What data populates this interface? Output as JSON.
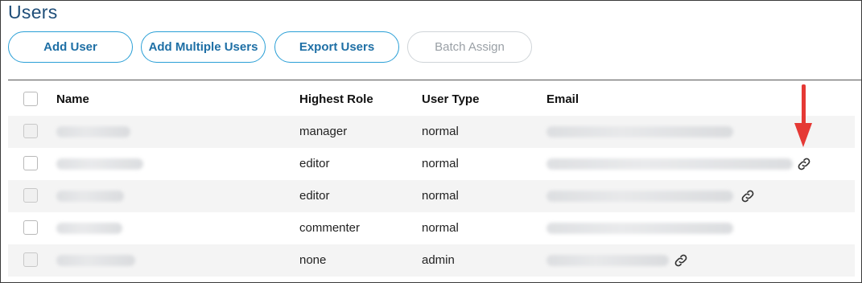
{
  "page": {
    "title": "Users"
  },
  "toolbar": {
    "buttons": [
      {
        "label": "Add User",
        "enabled": true
      },
      {
        "label": "Add Multiple Users",
        "enabled": true
      },
      {
        "label": "Export Users",
        "enabled": true
      },
      {
        "label": "Batch Assign",
        "enabled": false
      }
    ]
  },
  "table": {
    "headers": {
      "name": "Name",
      "role": "Highest Role",
      "type": "User Type",
      "email": "Email"
    },
    "rows": [
      {
        "role": "manager",
        "type": "normal",
        "email_link_icon": false
      },
      {
        "role": "editor",
        "type": "normal",
        "email_link_icon": true
      },
      {
        "role": "editor",
        "type": "normal",
        "email_link_icon": true
      },
      {
        "role": "commenter",
        "type": "normal",
        "email_link_icon": false
      },
      {
        "role": "none",
        "type": "admin",
        "email_link_icon": true
      }
    ]
  },
  "annotation": {
    "icon": "red-down-arrow",
    "color": "#e53935"
  },
  "colors": {
    "accent": "#2a9fd6",
    "title": "#1f4e79",
    "disabled": "#9aa0a6"
  }
}
